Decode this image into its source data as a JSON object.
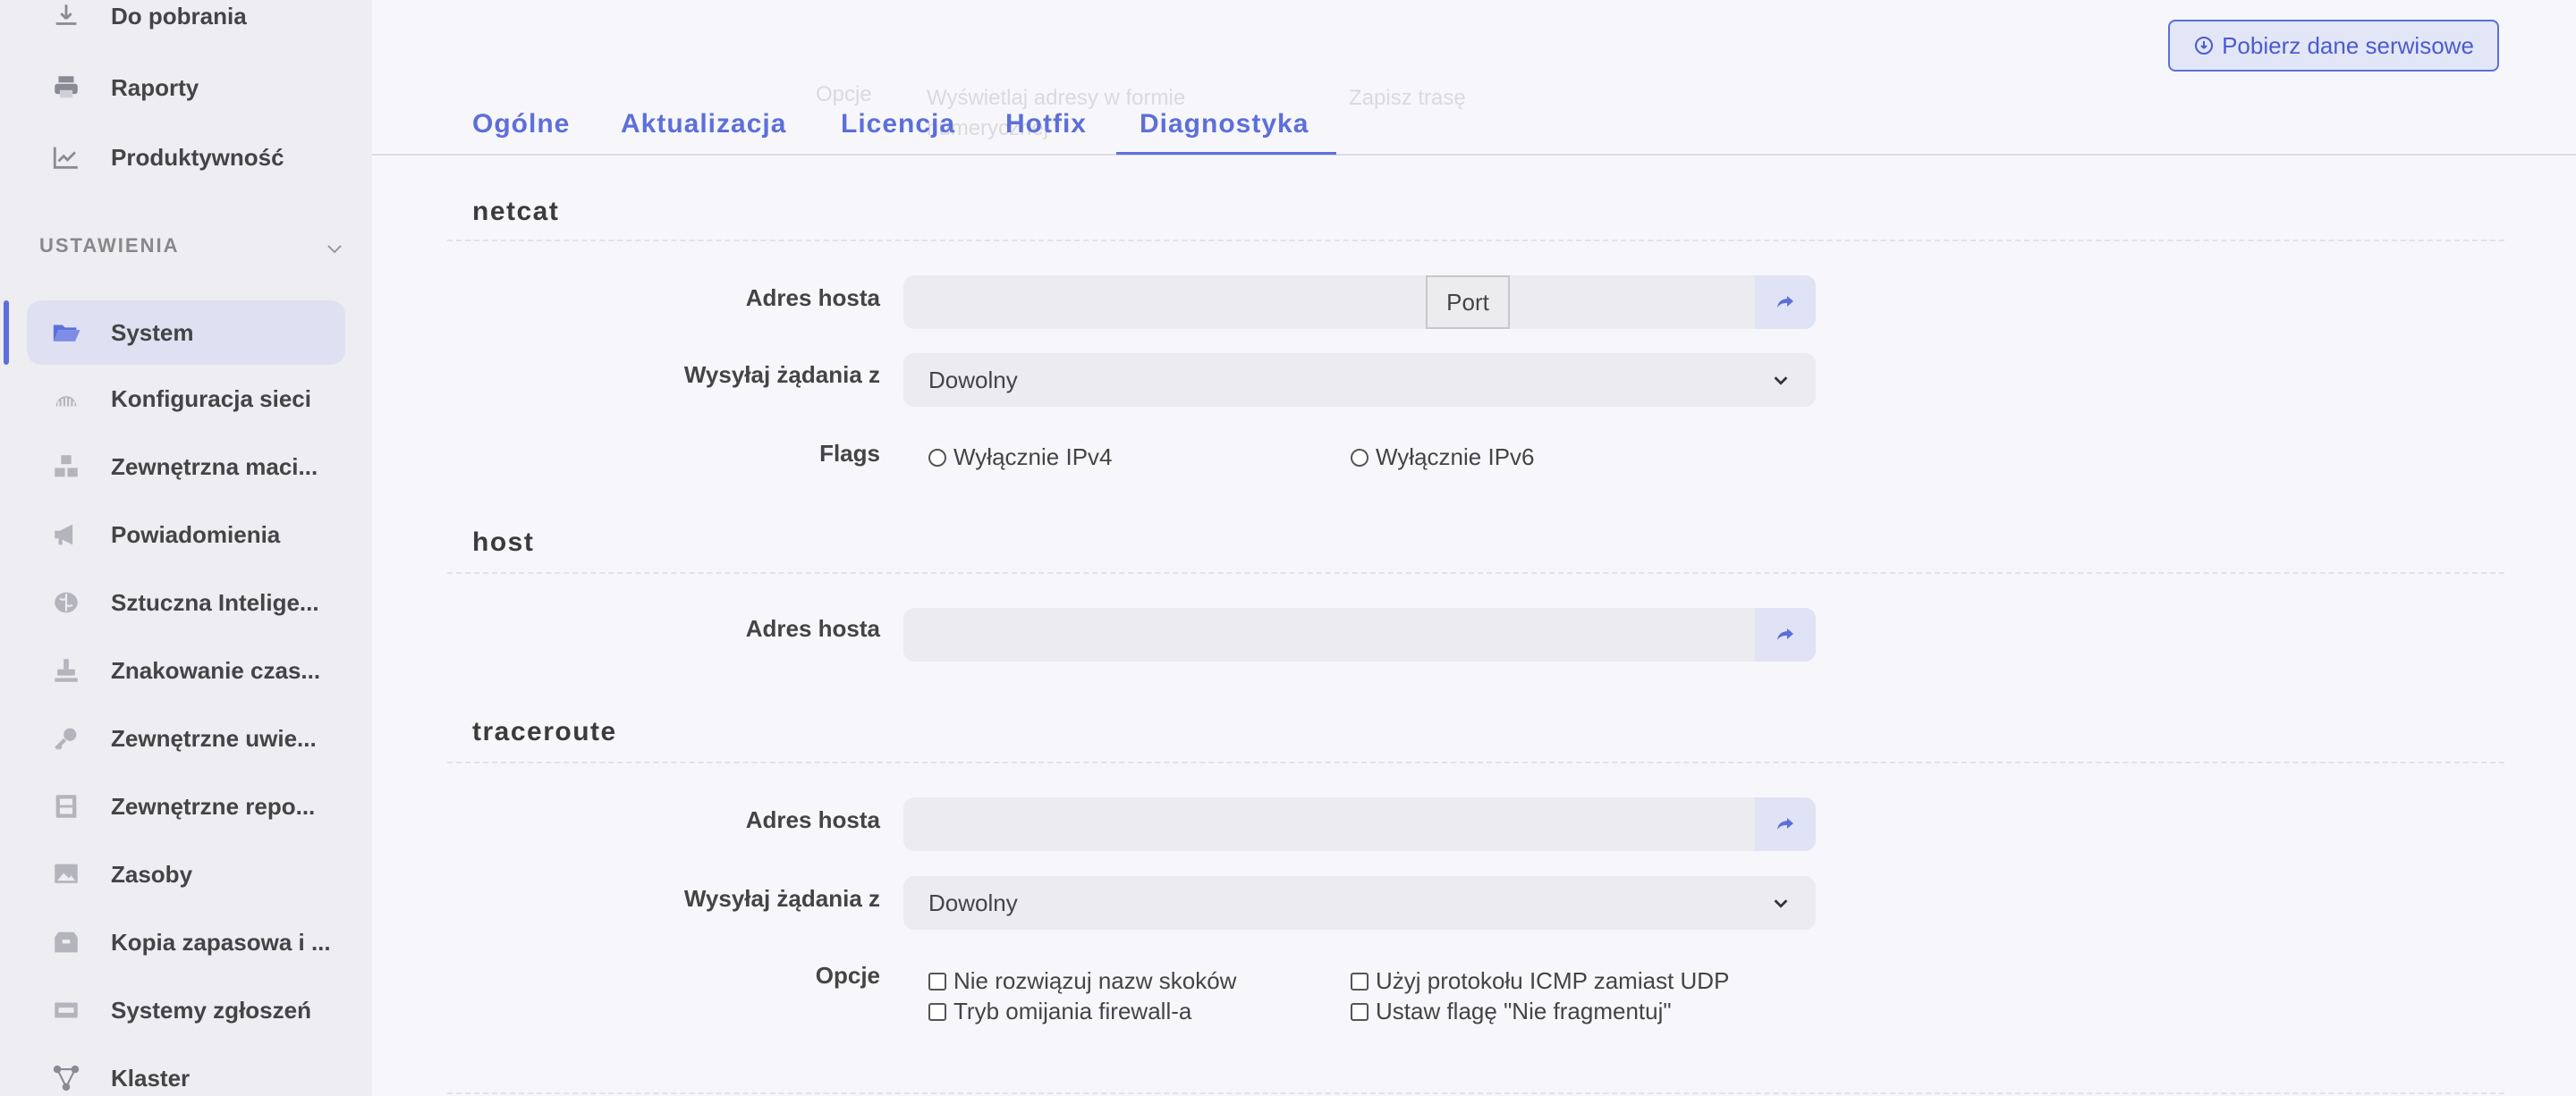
{
  "sidebar": {
    "top_items": [
      {
        "label": "Do pobrania",
        "icon": "download-icon"
      },
      {
        "label": "Raporty",
        "icon": "printer-icon"
      },
      {
        "label": "Produktywność",
        "icon": "chart-line-icon"
      }
    ],
    "section_label": "USTAWIENIA",
    "items": [
      {
        "label": "System",
        "icon": "folder-open-icon",
        "active": true
      },
      {
        "label": "Konfiguracja sieci",
        "icon": "network-icon"
      },
      {
        "label": "Zewnętrzna maci...",
        "icon": "cubes-icon"
      },
      {
        "label": "Powiadomienia",
        "icon": "megaphone-icon"
      },
      {
        "label": "Sztuczna Intelige...",
        "icon": "brain-icon"
      },
      {
        "label": "Znakowanie czas...",
        "icon": "stamp-icon"
      },
      {
        "label": "Zewnętrzne uwie...",
        "icon": "key-icon"
      },
      {
        "label": "Zewnętrzne repo...",
        "icon": "archive-icon"
      },
      {
        "label": "Zasoby",
        "icon": "image-icon"
      },
      {
        "label": "Kopia zapasowa i ...",
        "icon": "box-icon"
      },
      {
        "label": "Systemy zgłoszeń",
        "icon": "ticket-icon"
      },
      {
        "label": "Klaster",
        "icon": "cluster-icon"
      }
    ]
  },
  "header": {
    "service_button": "Pobierz dane serwisowe",
    "ghost_options_label": "Opcje",
    "ghost_option_1": "Wyświetlaj adresy w formie",
    "ghost_option_1b": "numerycznej",
    "ghost_option_2": "Zapisz trasę"
  },
  "tabs": [
    {
      "label": "Ogólne"
    },
    {
      "label": "Aktualizacja"
    },
    {
      "label": "Licencja"
    },
    {
      "label": "Hotfix"
    },
    {
      "label": "Diagnostyka",
      "active": true
    }
  ],
  "netcat": {
    "title": "netcat",
    "host_label": "Adres hosta",
    "host_value": "",
    "port_label": "Port",
    "send_from_label": "Wysyłaj żądania z",
    "send_from_value": "Dowolny",
    "flags_label": "Flags",
    "flag_ipv4": "Wyłącznie IPv4",
    "flag_ipv6": "Wyłącznie IPv6"
  },
  "host": {
    "title": "host",
    "host_label": "Adres hosta",
    "host_value": ""
  },
  "traceroute": {
    "title": "traceroute",
    "host_label": "Adres hosta",
    "host_value": "",
    "send_from_label": "Wysyłaj żądania z",
    "send_from_value": "Dowolny",
    "options_label": "Opcje",
    "opt_no_resolve": "Nie rozwiązuj nazw skoków",
    "opt_icmp": "Użyj protokołu ICMP zamiast UDP",
    "opt_firewall": "Tryb omijania firewall-a",
    "opt_dont_fragment": "Ustaw flagę \"Nie fragmentuj\""
  },
  "colors": {
    "accent": "#5d6fd9",
    "sidebar_bg": "#ededf2",
    "page_bg": "#f7f7fb"
  }
}
